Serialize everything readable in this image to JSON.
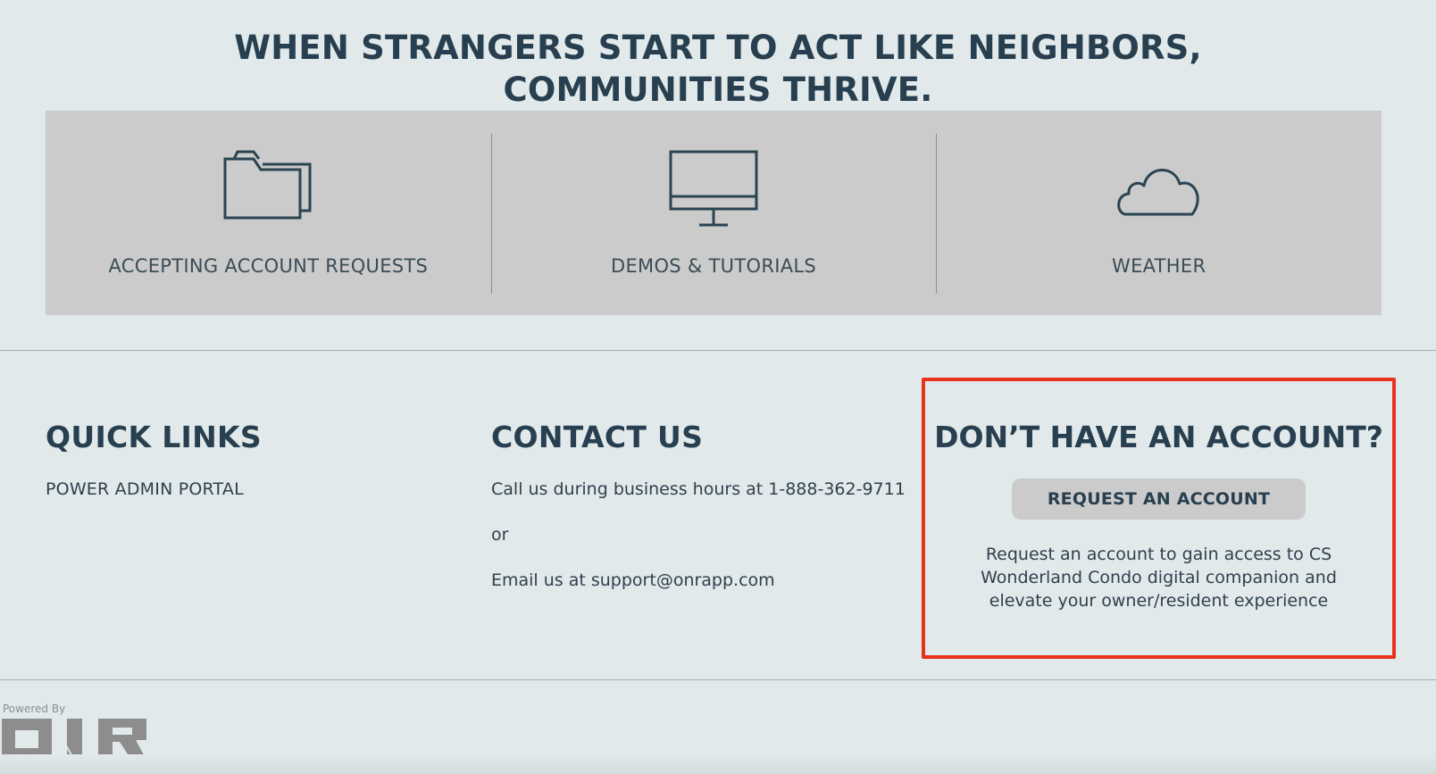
{
  "headline": "WHEN STRANGERS START TO ACT LIKE NEIGHBORS, COMMUNITIES THRIVE.",
  "features": [
    {
      "icon": "folder-icon",
      "label": "ACCEPTING ACCOUNT REQUESTS"
    },
    {
      "icon": "monitor-icon",
      "label": "DEMOS & TUTORIALS"
    },
    {
      "icon": "cloud-icon",
      "label": "WEATHER"
    }
  ],
  "quick_links": {
    "heading": "QUICK LINKS",
    "items": [
      "POWER ADMIN PORTAL"
    ]
  },
  "contact": {
    "heading": "CONTACT US",
    "phone_line": "Call us during business hours at 1-888-362-9711",
    "or": "or",
    "email_line": "Email us at support@onrapp.com"
  },
  "account": {
    "heading": "DON’T HAVE AN ACCOUNT?",
    "button": "REQUEST AN ACCOUNT",
    "description": "Request an account to gain access to CS Wonderland Condo digital companion and elevate your owner/resident experience"
  },
  "footer": {
    "powered_by": "Powered By",
    "logo": "ONR"
  },
  "colors": {
    "background": "#e1e9eb",
    "panel": "#cbcbcb",
    "heading": "#283f4f",
    "highlight": "#e8321e"
  }
}
